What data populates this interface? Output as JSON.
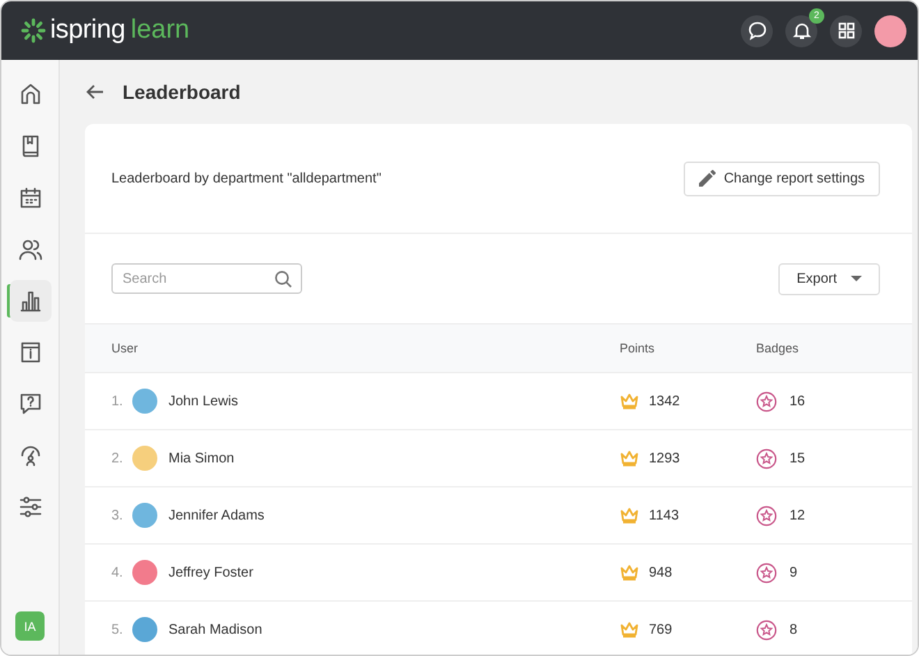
{
  "header": {
    "logo": {
      "brand": "ispring",
      "product": "learn"
    },
    "notifications_count": "2"
  },
  "sidebar": {
    "items": [
      {
        "selected": false
      },
      {
        "selected": false
      },
      {
        "selected": false
      },
      {
        "selected": false
      },
      {
        "selected": true
      },
      {
        "selected": false
      },
      {
        "selected": false
      },
      {
        "selected": false
      },
      {
        "selected": false
      }
    ],
    "user_initials": "IA"
  },
  "page": {
    "title": "Leaderboard"
  },
  "report": {
    "description": "Leaderboard by department \"alldepartment\"",
    "settings_button": "Change report settings"
  },
  "search": {
    "placeholder": "Search"
  },
  "export_button": "Export",
  "table": {
    "columns": [
      "User",
      "Points",
      "Badges"
    ],
    "rows": [
      {
        "rank": "1.",
        "name": "John Lewis",
        "points": "1342",
        "badges": "16",
        "color": "#6fb6de"
      },
      {
        "rank": "2.",
        "name": "Mia Simon",
        "points": "1293",
        "badges": "15",
        "color": "#f6cf7d"
      },
      {
        "rank": "3.",
        "name": "Jennifer Adams",
        "points": "1143",
        "badges": "12",
        "color": "#6fb6de"
      },
      {
        "rank": "4.",
        "name": "Jeffrey Foster",
        "points": "948",
        "badges": "9",
        "color": "#f27b8c"
      },
      {
        "rank": "5.",
        "name": "Sarah Madison",
        "points": "769",
        "badges": "8",
        "color": "#5aa7d6"
      }
    ]
  }
}
